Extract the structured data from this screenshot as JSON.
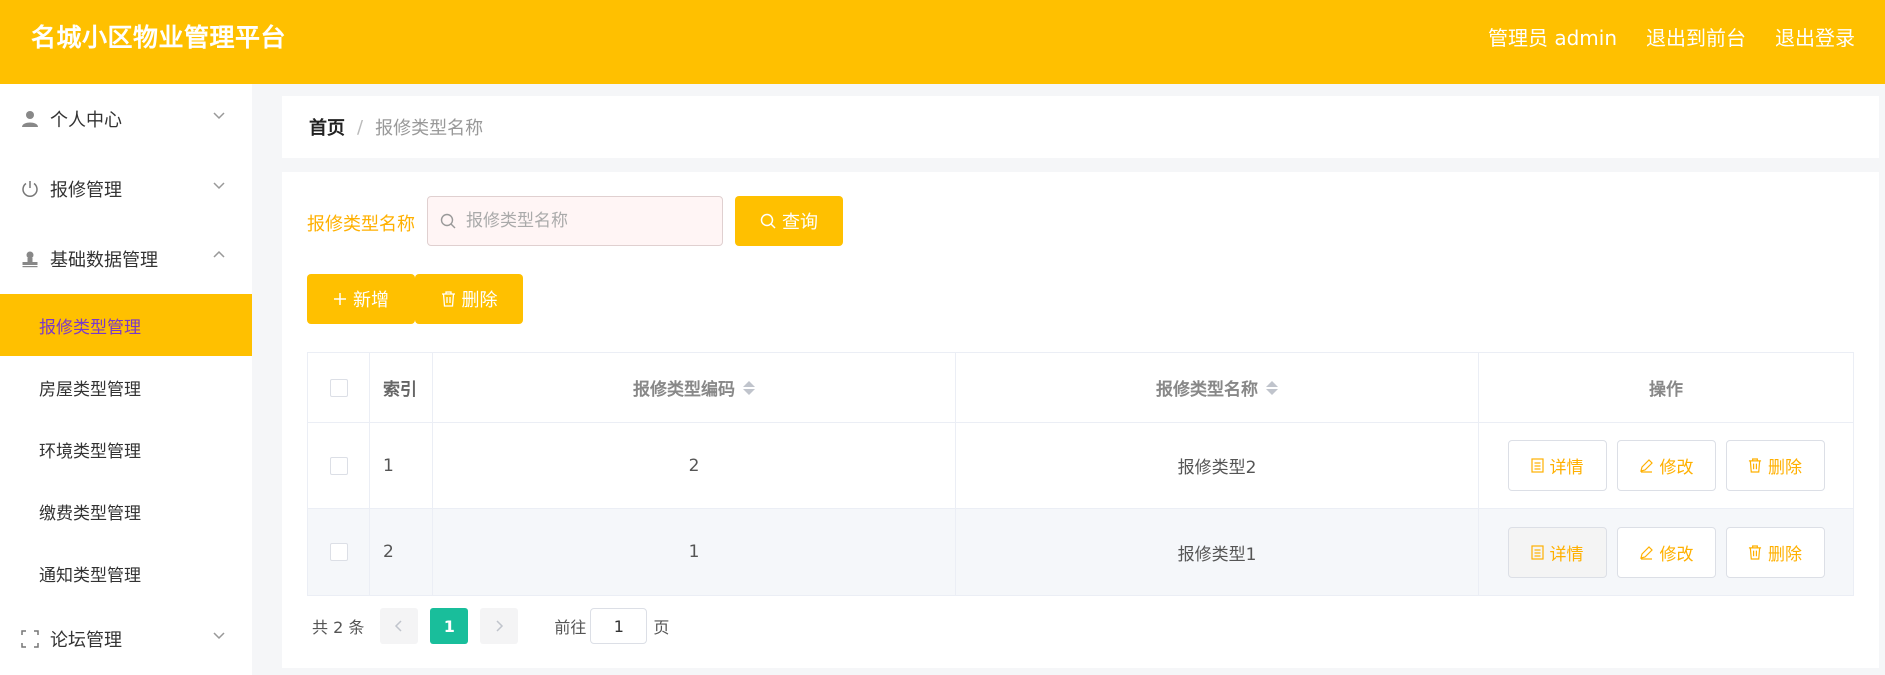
{
  "header": {
    "logo": "名城小区物业管理平台",
    "admin_label": "管理员 admin",
    "front_link": "退出到前台",
    "logout_link": "退出登录"
  },
  "sidebar": {
    "groups": [
      {
        "label": "个人中心",
        "icon": "user-icon",
        "expanded": false
      },
      {
        "label": "报修管理",
        "icon": "power-icon",
        "expanded": false
      },
      {
        "label": "基础数据管理",
        "icon": "stamp-icon",
        "expanded": true
      },
      {
        "label": "论坛管理",
        "icon": "fullscreen-icon",
        "expanded": false
      }
    ],
    "sub_items": [
      {
        "label": "报修类型管理",
        "active": true
      },
      {
        "label": "房屋类型管理"
      },
      {
        "label": "环境类型管理"
      },
      {
        "label": "缴费类型管理"
      },
      {
        "label": "通知类型管理"
      }
    ]
  },
  "breadcrumb": {
    "home": "首页",
    "separator": "/",
    "current": "报修类型名称"
  },
  "search": {
    "label": "报修类型名称",
    "placeholder": "报修类型名称",
    "value": "",
    "query_button": "查询"
  },
  "toolbar": {
    "add_button": "新增",
    "delete_button": "删除"
  },
  "table": {
    "columns": {
      "index": "索引",
      "code": "报修类型编码",
      "name": "报修类型名称",
      "ops": "操作"
    },
    "rows": [
      {
        "index": "1",
        "code": "2",
        "name": "报修类型2"
      },
      {
        "index": "2",
        "code": "1",
        "name": "报修类型1"
      }
    ],
    "op_labels": {
      "detail": "详情",
      "edit": "修改",
      "delete": "删除"
    }
  },
  "pagination": {
    "total": "共 2 条",
    "current_page": "1",
    "goto_label": "前往",
    "goto_value": "1",
    "page_unit": "页"
  },
  "colors": {
    "accent": "#ffc000",
    "active_text": "#7a39c9",
    "page_active": "#19be9b"
  }
}
